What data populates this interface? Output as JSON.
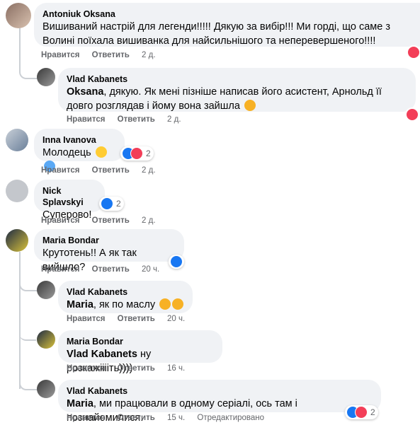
{
  "actions": {
    "like": "Нравится",
    "reply": "Ответить"
  },
  "comments": [
    {
      "name": "Antoniuk Oksana",
      "text": "Вишиваний настрій для легенди!!!!! Дякую за вибір!!! Ми горді, що саме з Волині поїхала вишиванка для найсильнішого та неперевершеного!!!!",
      "time": "2 д."
    },
    {
      "name": "Vlad Kabanets",
      "mention": "Oksana",
      "text": ", дякую. Як мені пізніше написав його асистент, Арнольд її довго розглядав і йому вона зайшла",
      "emoji": "smile-emoji",
      "time": "2 д."
    },
    {
      "name": "Inna Ivanova",
      "text": "Молодець",
      "emoji": "yellow-heart blue-heart",
      "time": "2 д.",
      "reactions": "2"
    },
    {
      "name": "Nick Splavskyi",
      "text": "Суперово!",
      "time": "2 д.",
      "reactions": "2"
    },
    {
      "name": "Maria Bondar",
      "text": "Крутотень!! А як так вийшло?",
      "time": "20 ч."
    },
    {
      "name": "Vlad Kabanets",
      "mention": "Maria",
      "text": ", як по маслу",
      "emoji": "wink-emoji laugh-emoji",
      "time": "20 ч."
    },
    {
      "name": "Maria Bondar",
      "mention": "Vlad Kabanets",
      "text": " ну розкажііііть))))",
      "time": "16 ч."
    },
    {
      "name": "Vlad Kabanets",
      "mention": "Maria",
      "text": ", ми працювали в одному серіалі, ось там і познайомилися.",
      "time": "15 ч.",
      "edited": "Отредактировано",
      "reactions": "2"
    }
  ],
  "colors": {
    "like": "#1877f2",
    "love": "#f33e58",
    "bubble": "#f0f2f5",
    "meta": "#65676b"
  }
}
